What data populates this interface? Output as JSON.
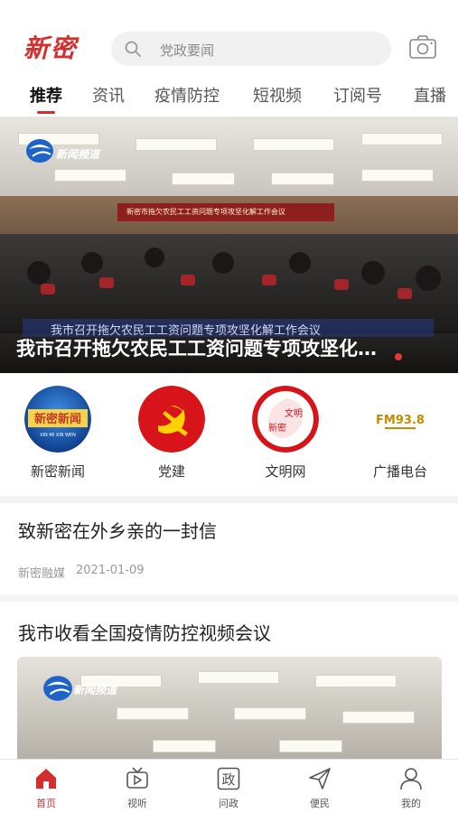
{
  "header": {
    "logo": "新密",
    "search_placeholder": "党政要闻"
  },
  "tabs": [
    {
      "label": "推荐",
      "active": true
    },
    {
      "label": "资讯"
    },
    {
      "label": "疫情防控"
    },
    {
      "label": "短视频"
    },
    {
      "label": "订阅号"
    },
    {
      "label": "直播"
    }
  ],
  "hero": {
    "channel_logo_text": "新闻频道",
    "stage_banner": "新密市拖欠农民工工资问题专项攻坚化解工作会议",
    "subtitle": "我市召开拖欠农民工工资问题专项攻坚化解工作会议",
    "title": "我市召开拖欠农民工工资问题专项攻坚化…"
  },
  "entries": [
    {
      "label": "新密新闻",
      "icon_text": "新密新闻",
      "icon_sub": "XIN MI XIN WEN"
    },
    {
      "label": "党建"
    },
    {
      "label": "文明网",
      "icon_text_a": "文明",
      "icon_text_b": "新密"
    },
    {
      "label": "广播电台",
      "icon_text": "FM93.8"
    }
  ],
  "news": [
    {
      "title": "致新密在外乡亲的一封信",
      "source": "新密融媒",
      "date": "2021-01-09"
    },
    {
      "title": "我市收看全国疫情防控视频会议",
      "image_logo_text": "新闻频道"
    }
  ],
  "bottom_nav": [
    {
      "label": "首页",
      "icon": "home-icon",
      "active": true
    },
    {
      "label": "视听",
      "icon": "tv-icon"
    },
    {
      "label": "问政",
      "icon": "zheng-icon",
      "icon_text": "政"
    },
    {
      "label": "便民",
      "icon": "send-icon"
    },
    {
      "label": "我的",
      "icon": "user-icon"
    }
  ],
  "colors": {
    "brand": "#d32f2f",
    "tab_underline": "#d32f2f",
    "nav_active": "#d32f2f"
  }
}
